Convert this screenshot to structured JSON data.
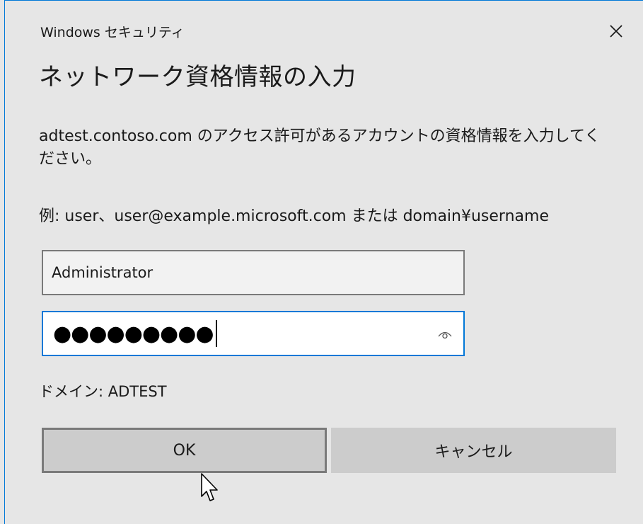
{
  "window": {
    "title": "Windows セキュリティ",
    "close_icon": "close-icon"
  },
  "dialog": {
    "heading": "ネットワーク資格情報の入力",
    "description": "adtest.contoso.com のアクセス許可があるアカウントの資格情報を入力してください。",
    "example": "例: user、user@example.microsoft.com または domain¥username",
    "username_value": "Administrator",
    "password_masked": "●●●●●●●●●",
    "reveal_icon": "eye-icon",
    "domain_label": "ドメイン: ADTEST"
  },
  "buttons": {
    "ok_label": "OK",
    "cancel_label": "キャンセル"
  },
  "colors": {
    "accent": "#0078d7",
    "background": "#e6e6e6",
    "button": "#cccccc",
    "border": "#7a7a7a"
  }
}
